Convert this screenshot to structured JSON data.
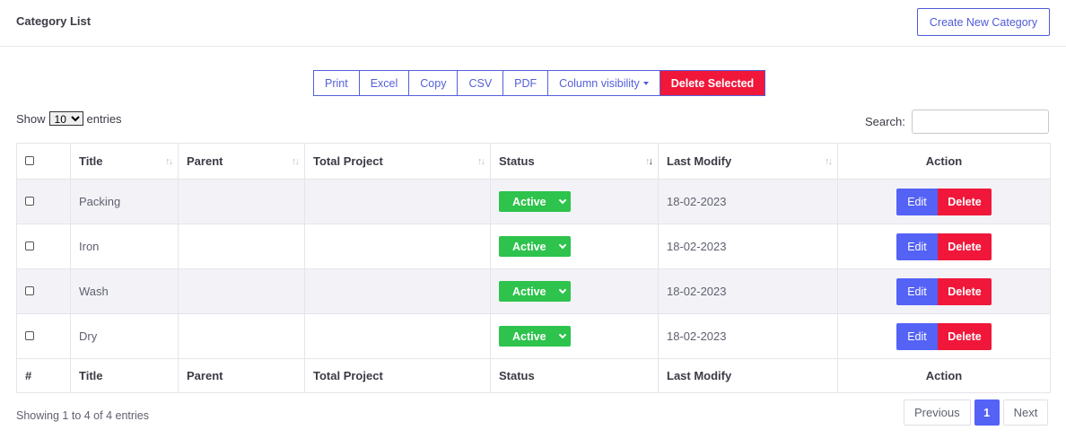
{
  "header": {
    "title": "Category List",
    "create_label": "Create New Category"
  },
  "toolbar": {
    "buttons": [
      "Print",
      "Excel",
      "Copy",
      "CSV",
      "PDF"
    ],
    "column_visibility_label": "Column visibility",
    "delete_selected_label": "Delete Selected"
  },
  "length": {
    "show_label": "Show",
    "value": "10",
    "entries_label": "entries"
  },
  "search": {
    "label": "Search:",
    "value": "",
    "placeholder": ""
  },
  "table": {
    "columns": [
      "Title",
      "Parent",
      "Total Project",
      "Status",
      "Last Modify",
      "Action"
    ],
    "rows": [
      {
        "title": "Packing",
        "parent": "",
        "total_project": "",
        "status": "Active",
        "last_modify": "18-02-2023"
      },
      {
        "title": "Iron",
        "parent": "",
        "total_project": "",
        "status": "Active",
        "last_modify": "18-02-2023"
      },
      {
        "title": "Wash",
        "parent": "",
        "total_project": "",
        "status": "Active",
        "last_modify": "18-02-2023"
      },
      {
        "title": "Dry",
        "parent": "",
        "total_project": "",
        "status": "Active",
        "last_modify": "18-02-2023"
      }
    ],
    "footer": [
      "#",
      "Title",
      "Parent",
      "Total Project",
      "Status",
      "Last Modify",
      "Action"
    ],
    "edit_label": "Edit",
    "delete_label": "Delete"
  },
  "info": "Showing 1 to 4 of 4 entries",
  "pagination": {
    "previous": "Previous",
    "current": "1",
    "next": "Next"
  },
  "colors": {
    "primary": "#5462f5",
    "danger": "#f0173a",
    "success": "#2dc34c"
  }
}
